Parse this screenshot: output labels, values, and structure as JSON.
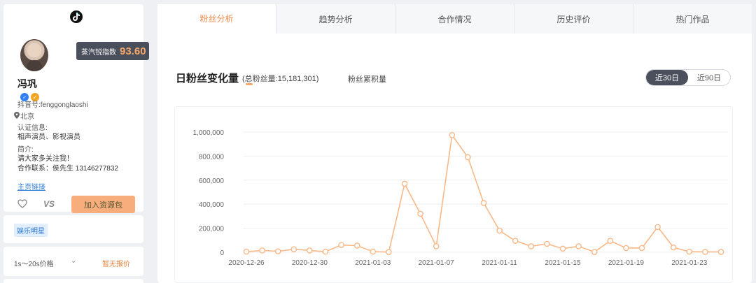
{
  "profile": {
    "platform_icon": "tiktok-icon",
    "index_label": "蒸汽锐指数",
    "index_value": "93.60",
    "name": "冯巩",
    "douyin_id": "抖音号:fenggonglaoshi",
    "location": "北京",
    "cert_label": "认证信息:",
    "cert_value": "相声演员、影视演员",
    "intro_label": "简介:",
    "intro_line1": "请大家多关注我！",
    "intro_line2": "合作联系：侯先生 13146277832",
    "homepage_link": "主页链接",
    "vs_label": "VS",
    "add_button": "加入资源包",
    "tag": "娱乐明星",
    "price_label": "1s～20s价格",
    "price_value": "暂无报价"
  },
  "tabs": [
    {
      "label": "粉丝分析",
      "active": true
    },
    {
      "label": "趋势分析",
      "active": false
    },
    {
      "label": "合作情况",
      "active": false
    },
    {
      "label": "历史评价",
      "active": false
    },
    {
      "label": "热门作品",
      "active": false
    }
  ],
  "section": {
    "title": "日粉丝变化量",
    "total": "(总粉丝量:15,181,301)",
    "cumulative": "粉丝累积量",
    "range_options": [
      {
        "label": "近30日",
        "active": true
      },
      {
        "label": "近90日",
        "active": false
      }
    ]
  },
  "colors": {
    "accent": "#f08a4b",
    "line": "#f8b888"
  },
  "chart_data": {
    "type": "line",
    "title": "",
    "xlabel": "",
    "ylabel": "",
    "ylim": [
      0,
      1000000
    ],
    "yticks": [
      0,
      200000,
      400000,
      600000,
      800000,
      1000000
    ],
    "ytick_labels": [
      "0",
      "200,000",
      "400,000",
      "600,000",
      "800,000",
      "1,000,000"
    ],
    "x": [
      "2020-12-26",
      "2020-12-27",
      "2020-12-28",
      "2020-12-29",
      "2020-12-30",
      "2020-12-31",
      "2021-01-01",
      "2021-01-02",
      "2021-01-03",
      "2021-01-04",
      "2021-01-05",
      "2021-01-06",
      "2021-01-07",
      "2021-01-08",
      "2021-01-09",
      "2021-01-10",
      "2021-01-11",
      "2021-01-12",
      "2021-01-13",
      "2021-01-14",
      "2021-01-15",
      "2021-01-16",
      "2021-01-17",
      "2021-01-18",
      "2021-01-19",
      "2021-01-20",
      "2021-01-21",
      "2021-01-22",
      "2021-01-23",
      "2021-01-24",
      "2021-01-25"
    ],
    "xtick_labels": [
      "2020-12-26",
      "2020-12-30",
      "2021-01-03",
      "2021-01-07",
      "2021-01-11",
      "2021-01-15",
      "2021-01-19",
      "2021-01-23"
    ],
    "series": [
      {
        "values": [
          5000,
          15000,
          8000,
          25000,
          15000,
          5000,
          60000,
          55000,
          5000,
          2000,
          570000,
          320000,
          50000,
          975000,
          790000,
          410000,
          180000,
          95000,
          50000,
          70000,
          30000,
          50000,
          2000,
          95000,
          35000,
          35000,
          210000,
          40000,
          5000,
          3000,
          3000
        ]
      }
    ],
    "grid": true,
    "legend": "none"
  }
}
